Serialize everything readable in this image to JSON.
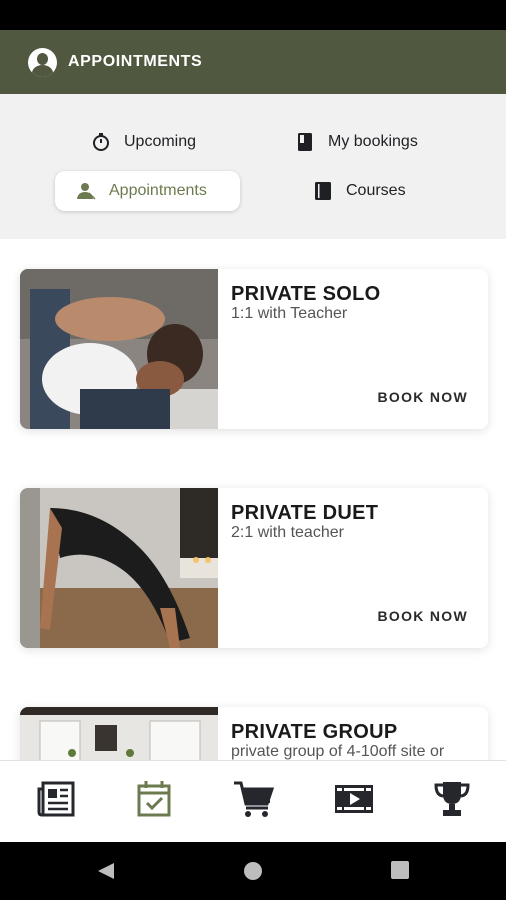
{
  "header": {
    "title": "APPOINTMENTS"
  },
  "tabs": {
    "upcoming": "Upcoming",
    "my_bookings": "My bookings",
    "appointments": "Appointments",
    "courses": "Courses"
  },
  "colors": {
    "accent": "#50583f",
    "active_tab_text": "#6c7b4f"
  },
  "cards": [
    {
      "title": "PRIVATE SOLO",
      "subtitle": "1:1 with Teacher",
      "button": "BOOK NOW"
    },
    {
      "title": "PRIVATE DUET",
      "subtitle": "2:1 with teacher",
      "button": "BOOK NOW"
    },
    {
      "title": "PRIVATE GROUP",
      "subtitle": "private group of 4-10off site or"
    }
  ],
  "bottom_nav": [
    {
      "icon": "newspaper-icon"
    },
    {
      "icon": "calendar-check-icon",
      "active": true
    },
    {
      "icon": "cart-icon"
    },
    {
      "icon": "video-icon"
    },
    {
      "icon": "trophy-icon"
    }
  ]
}
